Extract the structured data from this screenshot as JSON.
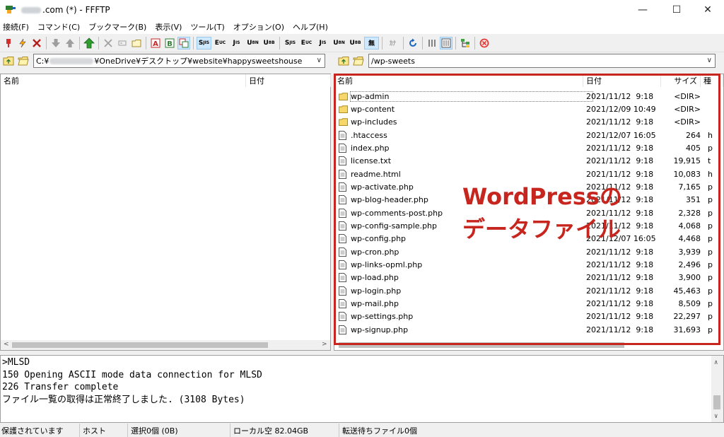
{
  "window": {
    "title_suffix": ".com (*) - FFFTP",
    "minimize": "—",
    "maximize": "☐",
    "close": "✕"
  },
  "menu": [
    "接続(F)",
    "コマンド(C)",
    "ブックマーク(B)",
    "表示(V)",
    "ツール(T)",
    "オプション(O)",
    "ヘルプ(H)"
  ],
  "toolbar": {
    "mode_labels": [
      "S",
      "E",
      "J",
      "U",
      "U",
      "S",
      "E",
      "J",
      "U",
      "U",
      "無",
      "ｶﾅ"
    ]
  },
  "local": {
    "path_prefix": "C:¥",
    "path_suffix": "¥OneDrive¥デスクトップ¥website¥happysweetshouse",
    "col_name": "名前",
    "col_date": "日付"
  },
  "remote": {
    "path": "/wp-sweets",
    "col_name": "名前",
    "col_date": "日付",
    "col_size": "サイズ",
    "col_extra": "種"
  },
  "files": [
    {
      "name": "wp-admin",
      "date": "2021/11/12  9:18",
      "size": "<DIR>",
      "type": "dir",
      "extra": ""
    },
    {
      "name": "wp-content",
      "date": "2021/12/09 10:49",
      "size": "<DIR>",
      "type": "dir",
      "extra": ""
    },
    {
      "name": "wp-includes",
      "date": "2021/11/12  9:18",
      "size": "<DIR>",
      "type": "dir",
      "extra": ""
    },
    {
      "name": ".htaccess",
      "date": "2021/12/07 16:05",
      "size": "264",
      "type": "file",
      "extra": "h"
    },
    {
      "name": "index.php",
      "date": "2021/11/12  9:18",
      "size": "405",
      "type": "file",
      "extra": "p"
    },
    {
      "name": "license.txt",
      "date": "2021/11/12  9:18",
      "size": "19,915",
      "type": "file",
      "extra": "t"
    },
    {
      "name": "readme.html",
      "date": "2021/11/12  9:18",
      "size": "10,083",
      "type": "file",
      "extra": "h"
    },
    {
      "name": "wp-activate.php",
      "date": "2021/11/12  9:18",
      "size": "7,165",
      "type": "file",
      "extra": "p"
    },
    {
      "name": "wp-blog-header.php",
      "date": "2021/11/12  9:18",
      "size": "351",
      "type": "file",
      "extra": "p"
    },
    {
      "name": "wp-comments-post.php",
      "date": "2021/11/12  9:18",
      "size": "2,328",
      "type": "file",
      "extra": "p"
    },
    {
      "name": "wp-config-sample.php",
      "date": "2021/11/12  9:18",
      "size": "4,068",
      "type": "file",
      "extra": "p"
    },
    {
      "name": "wp-config.php",
      "date": "2021/12/07 16:05",
      "size": "4,468",
      "type": "file",
      "extra": "p"
    },
    {
      "name": "wp-cron.php",
      "date": "2021/11/12  9:18",
      "size": "3,939",
      "type": "file",
      "extra": "p"
    },
    {
      "name": "wp-links-opml.php",
      "date": "2021/11/12  9:18",
      "size": "2,496",
      "type": "file",
      "extra": "p"
    },
    {
      "name": "wp-load.php",
      "date": "2021/11/12  9:18",
      "size": "3,900",
      "type": "file",
      "extra": "p"
    },
    {
      "name": "wp-login.php",
      "date": "2021/11/12  9:18",
      "size": "45,463",
      "type": "file",
      "extra": "p"
    },
    {
      "name": "wp-mail.php",
      "date": "2021/11/12  9:18",
      "size": "8,509",
      "type": "file",
      "extra": "p"
    },
    {
      "name": "wp-settings.php",
      "date": "2021/11/12  9:18",
      "size": "22,297",
      "type": "file",
      "extra": "p"
    },
    {
      "name": "wp-signup.php",
      "date": "2021/11/12  9:18",
      "size": "31,693",
      "type": "file",
      "extra": "p"
    }
  ],
  "annotation": {
    "line1": "WordPressの",
    "line2": "データファイル",
    "color": "#c7261f"
  },
  "log": [
    ">MLSD",
    "150 Opening ASCII mode data connection for MLSD",
    "226 Transfer complete",
    "ファイル一覧の取得は正常終了しました. (3108 Bytes)"
  ],
  "status": {
    "security": "保護されています",
    "host": "ホスト",
    "selection": "選択0個 (0B)",
    "local_free": "ローカル空 82.04GB",
    "queue": "転送待ちファイル0個"
  }
}
